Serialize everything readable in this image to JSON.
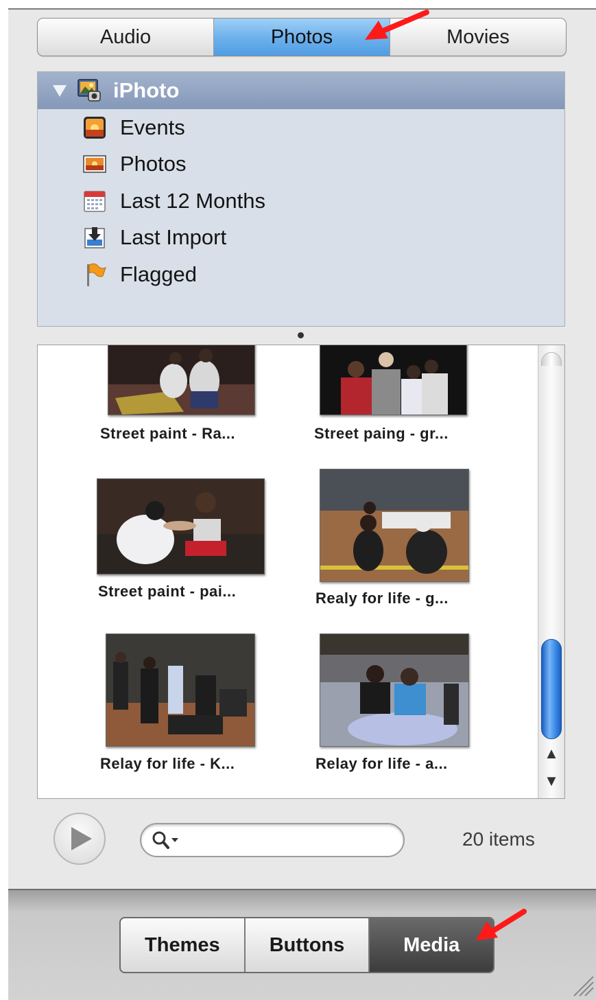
{
  "top_tabs": {
    "items": [
      {
        "label": "Audio"
      },
      {
        "label": "Photos"
      },
      {
        "label": "Movies"
      }
    ],
    "selected": "Photos"
  },
  "source_list": {
    "library": {
      "label": "iPhoto",
      "icon": "iphoto-icon"
    },
    "items": [
      {
        "label": "Events",
        "icon": "events-icon"
      },
      {
        "label": "Photos",
        "icon": "photos-icon"
      },
      {
        "label": "Last 12 Months",
        "icon": "calendar-icon"
      },
      {
        "label": "Last Import",
        "icon": "import-icon"
      },
      {
        "label": "Flagged",
        "icon": "flag-icon"
      }
    ]
  },
  "photos": [
    {
      "caption": "Street paint - Ra..."
    },
    {
      "caption": "Street paing - gr..."
    },
    {
      "caption": "Street paint - pai..."
    },
    {
      "caption": "Realy for life - g..."
    },
    {
      "caption": "Relay for life - K..."
    },
    {
      "caption": "Relay for life - a..."
    }
  ],
  "search": {
    "placeholder": "",
    "value": ""
  },
  "status": {
    "item_count": "20 items"
  },
  "bottom_tabs": {
    "items": [
      {
        "label": "Themes"
      },
      {
        "label": "Buttons"
      },
      {
        "label": "Media"
      }
    ],
    "selected": "Media"
  },
  "colors": {
    "selected_tab": "#6fb2ec",
    "source_header": "#8c9fbf",
    "source_bg": "#d8dfe8",
    "scroll_thumb": "#3e8ce6",
    "selected_bottom_tab": "#4a4a4a",
    "annotation_arrow": "#ff0000"
  }
}
